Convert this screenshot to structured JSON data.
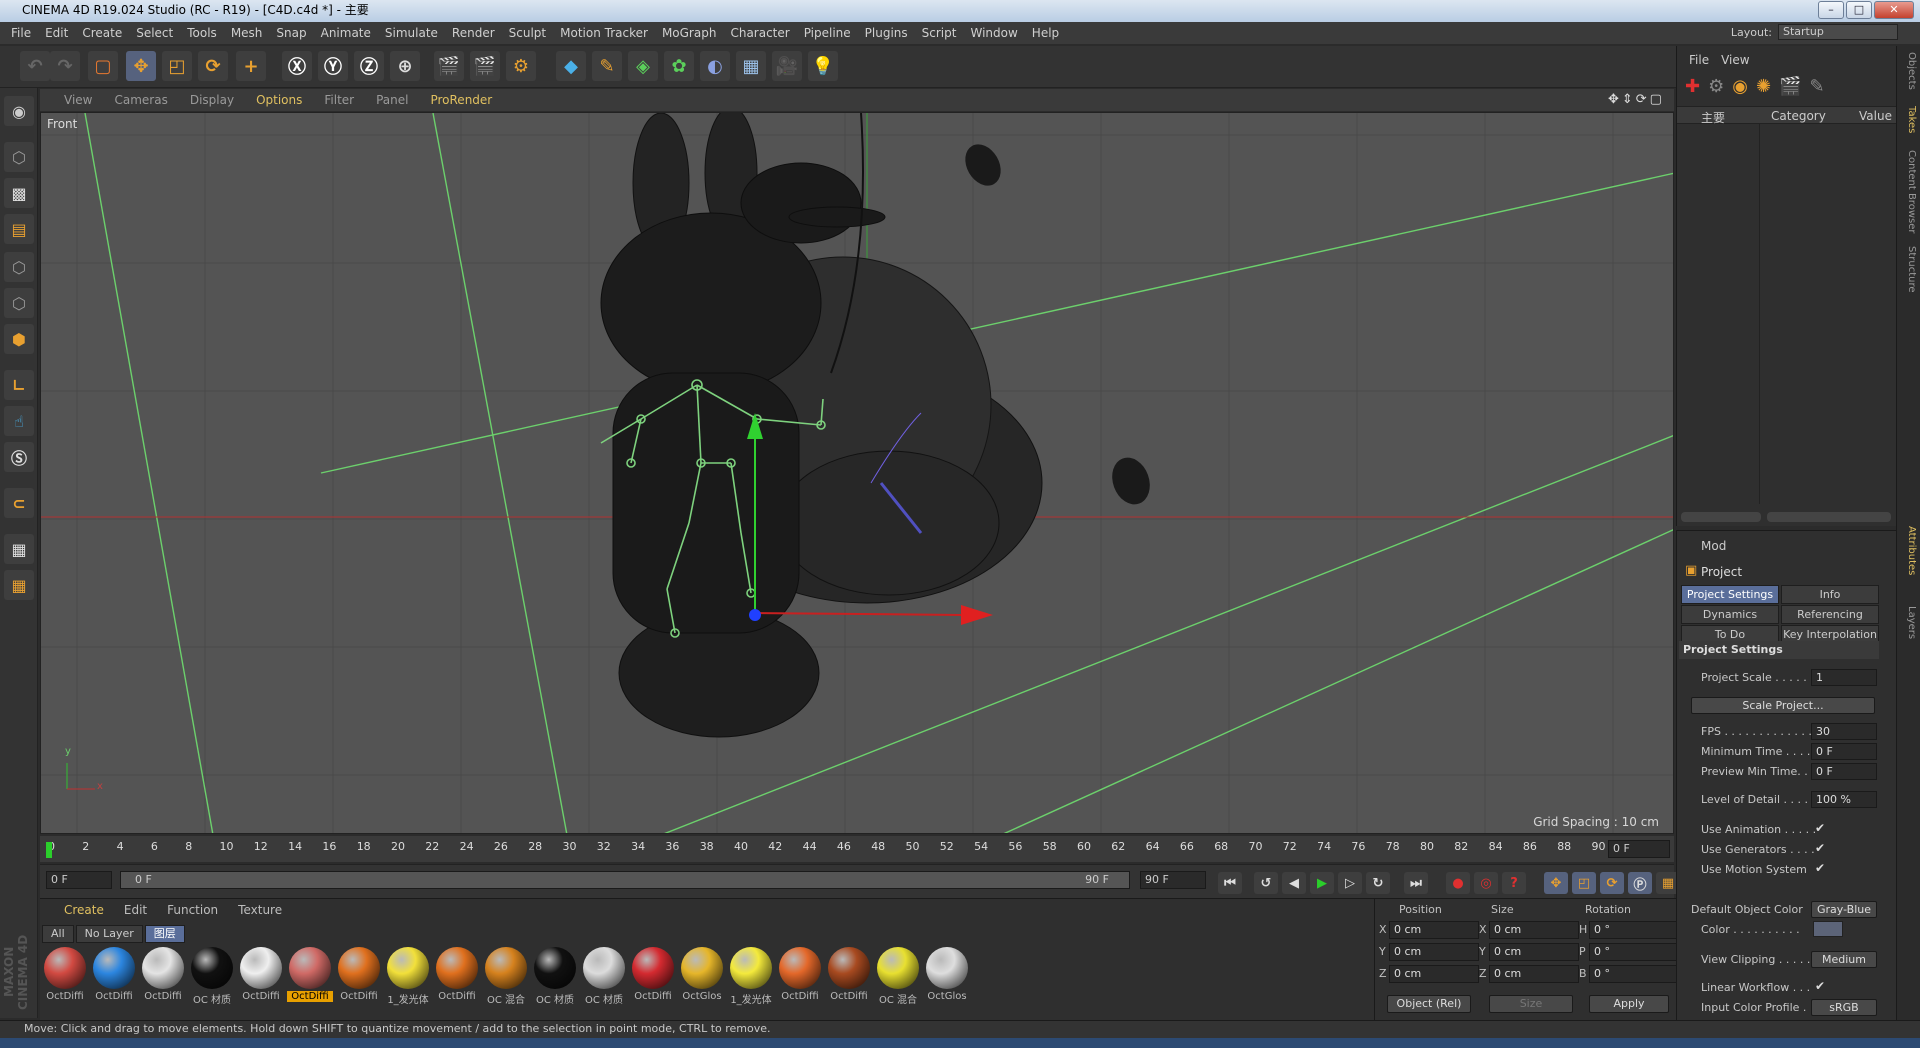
{
  "window": {
    "title": "CINEMA 4D R19.024 Studio (RC - R19) - [C4D.c4d *] - 主要"
  },
  "menu": [
    "File",
    "Edit",
    "Create",
    "Select",
    "Tools",
    "Mesh",
    "Snap",
    "Animate",
    "Simulate",
    "Render",
    "Sculpt",
    "Motion Tracker",
    "MoGraph",
    "Character",
    "Pipeline",
    "Plugins",
    "Script",
    "Window",
    "Help"
  ],
  "layout": {
    "label": "Layout:",
    "value": "Startup"
  },
  "viewport_menu": [
    "View",
    "Cameras",
    "Display",
    "Options",
    "Filter",
    "Panel",
    "ProRender"
  ],
  "viewport": {
    "name": "Front",
    "grid_spacing": "Grid Spacing : 10 cm",
    "axis_y": "y",
    "axis_x": "x"
  },
  "timeline": {
    "ticks": [
      "0",
      "2",
      "4",
      "6",
      "8",
      "10",
      "12",
      "14",
      "16",
      "18",
      "20",
      "22",
      "24",
      "26",
      "28",
      "30",
      "32",
      "34",
      "36",
      "38",
      "40",
      "42",
      "44",
      "46",
      "48",
      "50",
      "52",
      "54",
      "56",
      "58",
      "60",
      "62",
      "64",
      "66",
      "68",
      "70",
      "72",
      "74",
      "76",
      "78",
      "80",
      "82",
      "84",
      "86",
      "88",
      "90"
    ],
    "current": "0 F"
  },
  "transport": {
    "start": "0 F",
    "range_start": "0 F",
    "range_end": "90 F",
    "end": "90 F"
  },
  "materials": {
    "menu": [
      "Create",
      "Edit",
      "Function",
      "Texture"
    ],
    "tabs": [
      "All",
      "No Layer",
      "图层"
    ],
    "items": [
      {
        "label": "OctDiffi",
        "color": "#d24a42"
      },
      {
        "label": "OctDiffi",
        "color": "#2c86e0"
      },
      {
        "label": "OctDiffi",
        "color": "#e4e4e4"
      },
      {
        "label": "OC 材质",
        "color": "#111111"
      },
      {
        "label": "OctDiffi",
        "color": "#efefef"
      },
      {
        "label": "OctDiffi",
        "color": "#d06a66",
        "selected": true
      },
      {
        "label": "OctDiffi",
        "color": "#e0701e"
      },
      {
        "label": "1_发光体",
        "color": "#f2e03a"
      },
      {
        "label": "OctDiffi",
        "color": "#e0701e"
      },
      {
        "label": "OC 混合",
        "color": "#d6821e"
      },
      {
        "label": "OC 材质",
        "color": "#111111"
      },
      {
        "label": "OC 材质",
        "color": "#dcdcdc"
      },
      {
        "label": "OctDiffi",
        "color": "#d42a30"
      },
      {
        "label": "OctGlos",
        "color": "#e6b62a"
      },
      {
        "label": "1_发光体",
        "color": "#f4ea3c"
      },
      {
        "label": "OctDiffi",
        "color": "#e4682a"
      },
      {
        "label": "OctDiffi",
        "color": "#a84a20"
      },
      {
        "label": "OC 混合",
        "color": "#e8e030"
      },
      {
        "label": "OctGlos",
        "color": "#dedede"
      }
    ]
  },
  "coords": {
    "headers": [
      "Position",
      "Size",
      "Rotation"
    ],
    "rows": [
      {
        "axis": "X",
        "pos": "0 cm",
        "size_axis": "X",
        "size": "0 cm",
        "rot_axis": "H",
        "rot": "0 °"
      },
      {
        "axis": "Y",
        "pos": "0 cm",
        "size_axis": "Y",
        "size": "0 cm",
        "rot_axis": "P",
        "rot": "0 °"
      },
      {
        "axis": "Z",
        "pos": "0 cm",
        "size_axis": "Z",
        "size": "0 cm",
        "rot_axis": "B",
        "rot": "0 °"
      }
    ],
    "mode": "Object (Rel)",
    "size_mode": "Size",
    "apply": "Apply"
  },
  "objects": {
    "menu": [
      "File",
      "View"
    ],
    "tree_root": "主要",
    "col_category": "Category",
    "col_value": "Value"
  },
  "attributes": {
    "mode_label": "Mod",
    "object": "Project",
    "tabs": [
      "Project Settings",
      "Info",
      "Dynamics",
      "Referencing",
      "To Do",
      "Key Interpolation"
    ],
    "section": "Project Settings",
    "rows": [
      {
        "label": "Project Scale . . . . . .",
        "value": "1"
      },
      {
        "label": "FPS . . . . . . . . . . . . . . .",
        "value": "30"
      },
      {
        "label": "Minimum Time . . . . .",
        "value": "0 F"
      },
      {
        "label": "Preview Min Time. . .",
        "value": "0 F"
      },
      {
        "label": "Level of Detail . . . . .",
        "value": "100 %"
      }
    ],
    "scale_button": "Scale Project...",
    "checks": [
      {
        "label": "Use Animation . . . . .",
        "value": "✔"
      },
      {
        "label": "Use Generators . . . .",
        "value": "✔"
      },
      {
        "label": "Use Motion System",
        "value": "✔"
      }
    ],
    "color_label": "Default Object Color",
    "color_value": "Gray-Blue",
    "color2_label": "Color . . . . . . . . . .",
    "clipping_label": "View Clipping . . . . .",
    "clipping_value": "Medium",
    "linear_label": "Linear Workflow . . .",
    "linear_value": "✔",
    "profile_label": "Input Color Profile . .",
    "profile_value": "sRGB"
  },
  "right_tabs": [
    "Objects",
    "Takes",
    "Content Browser",
    "Structure",
    "Attributes",
    "Layers"
  ],
  "status": "Move: Click and drag to move elements. Hold down SHIFT to quantize movement / add to the selection in point mode, CTRL to remove.",
  "brand": "MAXON CINEMA 4D"
}
